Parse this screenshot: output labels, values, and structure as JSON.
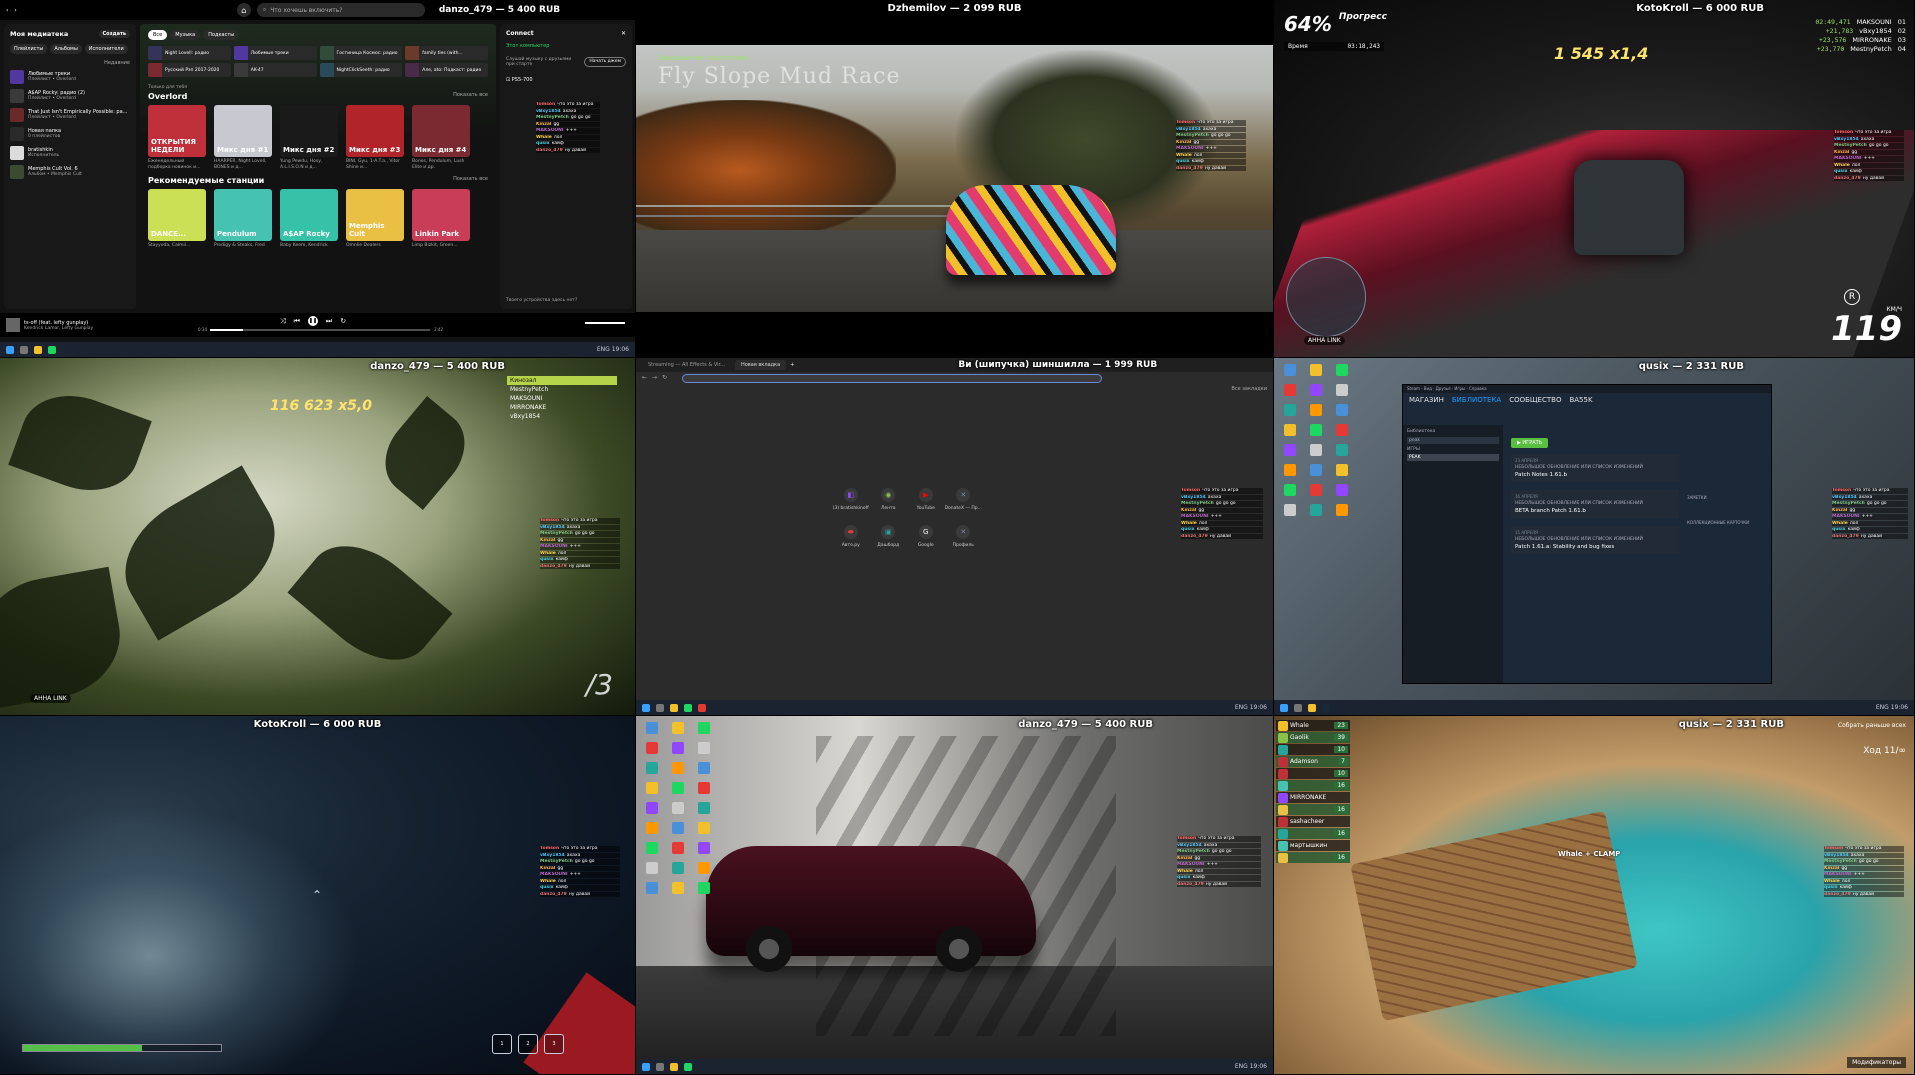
{
  "tiles": {
    "t1": {
      "label": "danzo_479 — 5 400 RUB",
      "spotify": {
        "search_placeholder": "Что хочешь включить?",
        "library_title": "Моя медиатека",
        "create_label": "Создать",
        "chips": [
          "Плейлисты",
          "Альбомы",
          "Исполнители"
        ],
        "sort_label": "Недавние",
        "library": [
          {
            "title": "Любимые треки",
            "sub": "Плейлист • Overlord",
            "color": "#5038a0"
          },
          {
            "title": "A$AP Rocky: радио (2)",
            "sub": "Плейлист • Overlord",
            "color": "#3a3a3a"
          },
          {
            "title": "That Just Isn't Empirically Possible: ра...",
            "sub": "Плейлист • Overlord",
            "color": "#6a2a2a"
          },
          {
            "title": "Новая папка",
            "sub": "0 плейлистов",
            "color": "#2a2a2a"
          },
          {
            "title": "bratishkin",
            "sub": "Исполнитель",
            "color": "#dcdcdc"
          },
          {
            "title": "Memphis Cult Vol. 6",
            "sub": "Альбом • Memphis Cult",
            "color": "#3b4a30"
          }
        ],
        "filters": [
          "Все",
          "Музыка",
          "Подкасты"
        ],
        "quick": [
          "Night Lovell: радио",
          "Любимые треки",
          "Гостиница Космос: радио",
          "family ties (with...",
          "Русский Рэп 2017-2020",
          "AK-47",
          "NightClickSeeth: радио",
          "Але, ato: Подкаст: радио"
        ],
        "section1": "Overlord",
        "section1_pre": "Только для тебя",
        "show_all": "Показать все",
        "cards1": [
          {
            "title": "ОТКРЫТИЯ НЕДЕЛИ",
            "cap": "Еженедельный подборка новинок и...",
            "color": "#c0303a"
          },
          {
            "title": "Микс дня #1",
            "cap": "HAARPER, Night Lovell, BONES и д...",
            "color": "#c8c8d0"
          },
          {
            "title": "Микс дня #2",
            "cap": "Yung Pewdu, Hosy, A.L.I.S.O.N и д...",
            "color": "#1a1a1a"
          },
          {
            "title": "Микс дня #3",
            "cap": "BINI, Gyu, 1-A.T.a., Vitor Shine и...",
            "color": "#b0242a"
          },
          {
            "title": "Микс дня #4",
            "cap": "Bones, Pendulum, Lush Elite и др.",
            "color": "#7a2a30"
          }
        ],
        "section2": "Рекомендуемые станции",
        "cards2": [
          {
            "title": "DANCE...",
            "cap": "Stayyoda, Calmii...",
            "color": "#cce056"
          },
          {
            "title": "Pendulum",
            "cap": "Prodigy & Steaks, Fred",
            "color": "#45c2b0"
          },
          {
            "title": "A$AP Rocky",
            "cap": "Baby Keem, Kendrick",
            "color": "#35c2a8"
          },
          {
            "title": "Memphis Cult",
            "cap": "Omnlie Dealers",
            "color": "#e9c043"
          },
          {
            "title": "Linkin Park",
            "cap": "Limp Bizkit, Green...",
            "color": "#c83d58"
          }
        ],
        "connect_title": "Connect",
        "connect_device": "Этот компьютер",
        "connect_hint": "Слушай музыку с друзьями при старте",
        "connect_start": "Начать джем",
        "connect_other": "PS5-700",
        "connect_footer": "Твоего устройства здесь нет?",
        "now_title": "ts-off (feat. lefty gunplay)",
        "now_artist": "Kendrick Lamar, Lefty Gunplay",
        "time_now": "0:34",
        "time_total": "3:42",
        "progress": 0.15
      }
    },
    "t2": {
      "label": "Dzhemilov — 2 099 RUB",
      "subtitle": "Завершение подготовки",
      "title": "Fly Slope Mud Race"
    },
    "t3": {
      "label": "KotoKroll — 6 000 RUB",
      "percent": "64%",
      "percent_label": "Прогресс",
      "time_label": "Время",
      "time_value": "03:18,243",
      "score": "1 545 x1,4",
      "board": [
        {
          "t": "02:49,471",
          "n": "MAKSOUNI",
          "p": "01"
        },
        {
          "t": "+21,783",
          "n": "vBxy1854",
          "p": "02"
        },
        {
          "t": "+23,576",
          "n": "MIRRONAKE",
          "p": "03"
        },
        {
          "t": "+23,770",
          "n": "MestnyPetch",
          "p": "04"
        }
      ],
      "speed": "119",
      "speed_unit": "КМ/Ч",
      "gear": "R",
      "tag": "АННА   LINK"
    },
    "t4": {
      "label": "danzo_479 — 5 400 RUB",
      "score": "116 623 x5,0",
      "board": [
        "Кинозал",
        "MestnyPetch",
        "MAKSOUNI",
        "MIRRONAKE",
        "vBxy1854"
      ],
      "num": "/3",
      "tag": "АННА   LINK"
    },
    "t5": {
      "label": "Ви (шипучка) шиншилла — 1 999 RUB",
      "tabs": [
        "Streaming — All Effects & Vir...",
        "Новая вкладка"
      ],
      "bookmarks": "Все закладки",
      "shortcuts": [
        {
          "label": "(3) bratishkinoff",
          "icon": "twitch-icon",
          "glyph": "◧",
          "color": "#9146ff"
        },
        {
          "label": "Лента",
          "icon": "feed-icon",
          "glyph": "◉",
          "color": "#8bc34a"
        },
        {
          "label": "YouTube",
          "icon": "youtube-icon",
          "glyph": "▶",
          "color": "#ff0000"
        },
        {
          "label": "DonateX — Пр...",
          "icon": "donate-icon",
          "glyph": "✕",
          "color": "#7a8aa8"
        },
        {
          "label": "Авто.ру",
          "icon": "car-icon",
          "glyph": "⬬",
          "color": "#e53935"
        },
        {
          "label": "Дашборд",
          "icon": "dashboard-icon",
          "glyph": "▣",
          "color": "#26a69a"
        },
        {
          "label": "Google",
          "icon": "google-icon",
          "glyph": "G",
          "color": "#ffffff"
        },
        {
          "label": "Профиль",
          "icon": "profile-icon",
          "glyph": "✕",
          "color": "#7a8aa8"
        }
      ]
    },
    "t6": {
      "label": "qusix — 2 331 RUB",
      "nav": [
        "МАГАЗИН",
        "БИБЛИОТЕКА",
        "СООБЩЕСТВО",
        "BA55K"
      ],
      "play": "▶ ИГРАТЬ",
      "news": [
        {
          "date": "23 АПРЕЛЯ",
          "kind": "НЕБОЛЬШОЕ ОБНОВЛЕНИЕ ИЛИ СПИСОК ИЗМЕНЕНИЙ",
          "title": "Patch Notes 1.61.b"
        },
        {
          "date": "16 АПРЕЛЯ",
          "kind": "НЕБОЛЬШОЕ ОБНОВЛЕНИЕ ИЛИ СПИСОК ИЗМЕНЕНИЙ",
          "title": "BETA branch Patch 1.61.b"
        },
        {
          "date": "15 АПРЕЛЯ",
          "kind": "НЕБОЛЬШОЕ ОБНОВЛЕНИЕ ИЛИ СПИСОК ИЗМЕНЕНИЙ",
          "title": "Patch 1.61.a: Stability and bug fixes"
        }
      ],
      "side_title": "Библиотека",
      "side_search": "peak",
      "side_group": "ИГРЫ",
      "side_game": "PEAK",
      "right_notes": "ЗАМЕТКИ",
      "right_cards": "КОЛЛЕКЦИОННЫЕ КАРТОЧКИ"
    },
    "t7": {
      "label": "KotoKroll — 6 000 RUB",
      "health": 0.6,
      "slots": [
        "1",
        "2",
        "3"
      ]
    },
    "t8": {
      "label": "danzo_479 — 5 400 RUB"
    },
    "t9": {
      "label": "qusix — 2 331 RUB",
      "players": [
        {
          "name": "Whale",
          "lv": "23",
          "c": "#f2c02b"
        },
        {
          "name": "Gaolik",
          "lv": "39",
          "c": "#8bc34a"
        },
        {
          "name": "",
          "lv": "10",
          "c": "#26a69a"
        },
        {
          "name": "Adamson",
          "lv": "7",
          "c": "#c0303a"
        },
        {
          "name": "",
          "lv": "10",
          "c": "#c0303a"
        },
        {
          "name": "",
          "lv": "16",
          "c": "#45c2b0"
        },
        {
          "name": "MIRRONAKE",
          "lv": "",
          "c": "#9146ff"
        },
        {
          "name": "",
          "lv": "16",
          "c": "#e9c043"
        },
        {
          "name": "sashacheer",
          "lv": "",
          "c": "#c0303a"
        },
        {
          "name": "",
          "lv": "16",
          "c": "#26a69a"
        },
        {
          "name": "мартышкин",
          "lv": "",
          "c": "#45c2b0"
        },
        {
          "name": "",
          "lv": "16",
          "c": "#e9c043"
        }
      ],
      "turn": "Ход 11/∞",
      "collect": "Собрать раньше всех",
      "mod": "Модификаторы",
      "name": "Whale + CLAMP"
    }
  },
  "chat": [
    {
      "u": "Tomson",
      "c": "#ff6b6b",
      "m": "что это за игра"
    },
    {
      "u": "vBxy1854",
      "c": "#4fc3f7",
      "m": "ахаха"
    },
    {
      "u": "MestnyPetch",
      "c": "#81c784",
      "m": "go go go"
    },
    {
      "u": "Kinzal",
      "c": "#ffb74d",
      "m": "gg"
    },
    {
      "u": "MAKSOUNI",
      "c": "#ba68c8",
      "m": "+++"
    },
    {
      "u": "Whale",
      "c": "#ffd54f",
      "m": "лол"
    },
    {
      "u": "qusix",
      "c": "#4dd0e1",
      "m": "кайф"
    },
    {
      "u": "danzo_479",
      "c": "#e57373",
      "m": "ну давай"
    }
  ],
  "taskbar": {
    "lang": "ENG",
    "time": "19:06"
  }
}
